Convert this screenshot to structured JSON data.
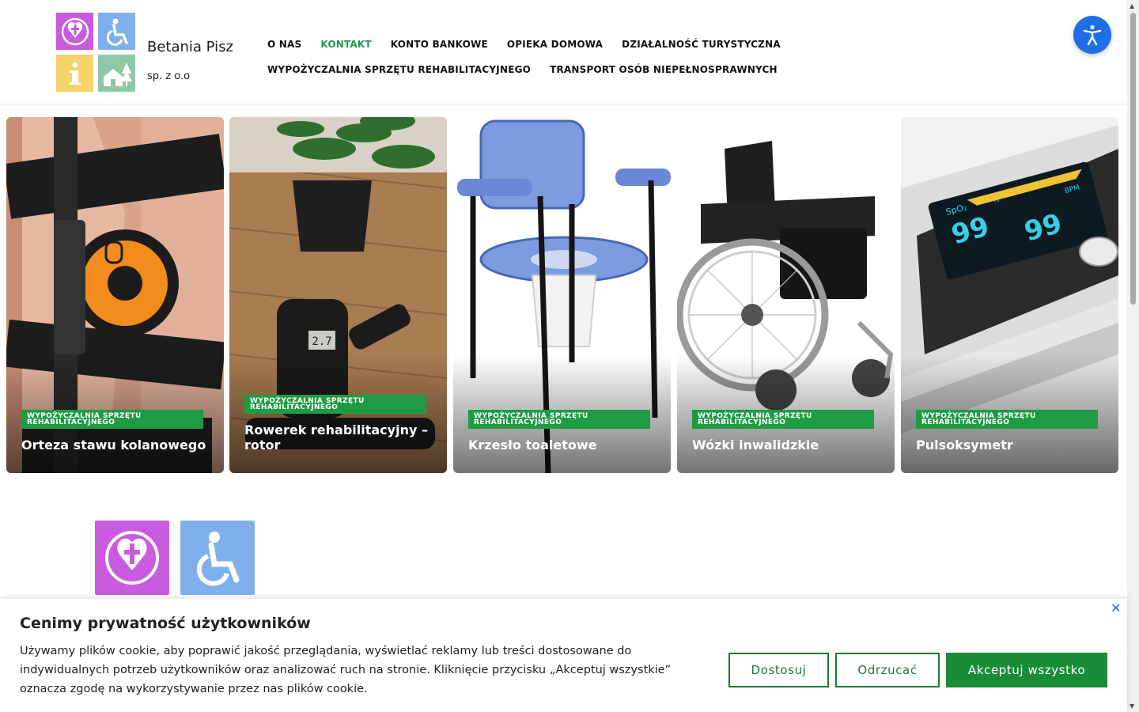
{
  "brand": {
    "name": "Betania Pisz",
    "sub": "sp. z o.o"
  },
  "nav": {
    "row1": [
      "O NAS",
      "KONTAKT",
      "KONTO BANKOWE",
      "OPIEKA DOMOWA",
      "DZIAŁALNOŚĆ TURYSTYCZNA"
    ],
    "row2": [
      "WYPOŻYCZALNIA SPRZĘTU REHABILITACYJNEGO",
      "TRANSPORT OSÓB NIEPEŁNOSPRAWNYCH"
    ],
    "active": "KONTAKT"
  },
  "cards": [
    {
      "category": "WYPOŻYCZALNIA SPRZĘTU REHABILITACYJNEGO",
      "title": "Orteza stawu kolanowego",
      "image": "knee-brace-photo"
    },
    {
      "category": "WYPOŻYCZALNIA SPRZĘTU REHABILITACYJNEGO",
      "title": "Rowerek rehabilitacyjny – rotor",
      "image": "mini-exercise-bike-photo"
    },
    {
      "category": "WYPOŻYCZALNIA SPRZĘTU REHABILITACYJNEGO",
      "title": "Krzesło toaletowe",
      "image": "commode-chair-photo"
    },
    {
      "category": "WYPOŻYCZALNIA SPRZĘTU REHABILITACYJNEGO",
      "title": "Wózki inwalidzkie",
      "image": "wheelchair-photo"
    },
    {
      "category": "WYPOŻYCZALNIA SPRZĘTU REHABILITACYJNEGO",
      "title": "Pulsoksymetr",
      "image": "pulse-oximeter-photo"
    }
  ],
  "oximeter": {
    "spo2": "99",
    "bpm": "99",
    "spo2_label": "SpO₂",
    "pct_label": "%",
    "bpm_label": "BPM"
  },
  "bike_display": "2.7",
  "cookie": {
    "title": "Cenimy prywatność użytkowników",
    "text": "Używamy plików cookie, aby poprawić jakość przeglądania, wyświetlać reklamy lub treści dostosowane do indywidualnych potrzeb użytkowników oraz analizować ruch na stronie. Kliknięcie przycisku „Akceptuj wszystkie” oznacza zgodę na wykorzystywanie przez nas plików cookie.",
    "customize": "Dostosuj",
    "reject": "Odrzucać",
    "accept": "Akceptuj wszystko",
    "close": "✕"
  },
  "colors": {
    "accent_green": "#1f9b44",
    "a11y_blue": "#1e6fe6",
    "tile_purple": "#c85bde",
    "tile_blue": "#7fb0eb",
    "tile_yellow": "#f4d36b",
    "tile_green": "#8fc8a6"
  },
  "icons": [
    "rose-cross-icon",
    "wheelchair-icon",
    "info-icon",
    "house-trees-icon",
    "accessibility-icon",
    "close-icon"
  ]
}
